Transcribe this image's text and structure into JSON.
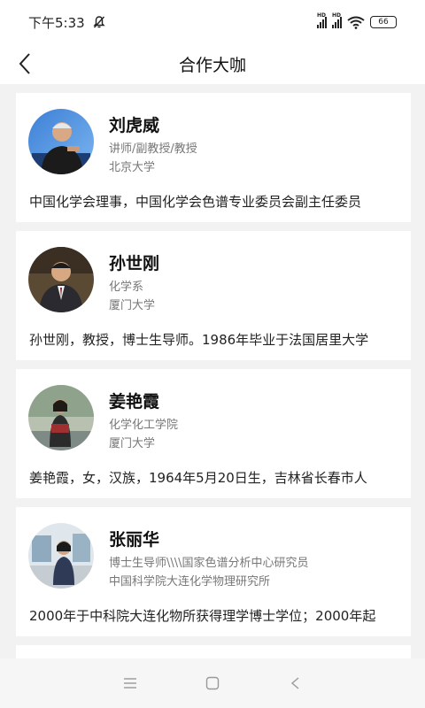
{
  "status_bar": {
    "time": "下午5:33",
    "battery": "66",
    "signal_label": "HD"
  },
  "header": {
    "title": "合作大咖"
  },
  "experts": [
    {
      "name": "刘虎威",
      "title": "讲师/副教授/教授",
      "org": "北京大学",
      "desc": "中国化学会理事，中国化学会色谱专业委员会副主任委员"
    },
    {
      "name": "孙世刚",
      "title": "化学系",
      "org": "厦门大学",
      "desc": "孙世刚，教授，博士生导师。1986年毕业于法国居里大学"
    },
    {
      "name": "姜艳霞",
      "title": "化学化工学院",
      "org": "厦门大学",
      "desc": "姜艳霞，女，汉族，1964年5月20日生，吉林省长春市人"
    },
    {
      "name": "张丽华",
      "title": "博士生导师\\\\\\\\国家色谱分析中心研究员",
      "org": "中国科学院大连化学物理研究所",
      "desc": "2000年于中科院大连化物所获得理学博士学位；2000年起"
    }
  ],
  "colors": {
    "background": "#f2f2f2",
    "card": "#ffffff",
    "primary_text": "#111111",
    "secondary_text": "#777777"
  }
}
